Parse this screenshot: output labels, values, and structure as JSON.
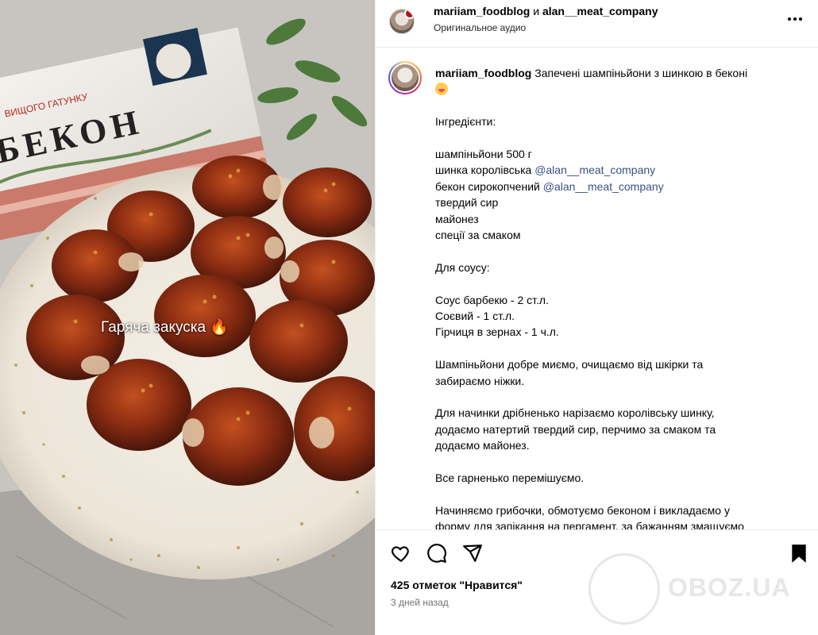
{
  "media": {
    "overlay_text": "Гаряча закуска",
    "package_text_top": "ВИЩОГО ГАТУНКУ",
    "package_text_main": "БЕКОН"
  },
  "header": {
    "user1": "mariiam_foodblog",
    "and": "и",
    "user2": "alan__meat_company",
    "audio": "Оригинальное аудио"
  },
  "caption": {
    "username": "mariiam_foodblog",
    "title": "Запечені шампіньйони з шинкою в беконі",
    "lines": [
      "",
      "Інгредієнти:",
      "",
      "шампіньйони 500 г"
    ],
    "ham_text": "шинка королівська ",
    "ham_mention": "@alan__meat_company",
    "bacon_text": "бекон сирокопчений ",
    "bacon_mention": "@alan__meat_company",
    "lines_after": [
      "твердий сир",
      "майонез",
      "спеції за смаком",
      "",
      "Для соусу:",
      "",
      "Соус барбекю - 2 ст.л.",
      "Соєвий - 1 ст.л.",
      "Гірчиця в зернах - 1 ч.л.",
      "",
      "Шампіньйони добре миємо, очищаємо від шкірки та",
      "забираємо ніжки.",
      "",
      "Для начинки дрібненько нарізаємо королівську шинку,",
      "додаємо натертий твердий сир, перчимо за смаком та",
      "додаємо майонез.",
      "",
      "Все гарненько перемішуємо.",
      "",
      "Начиняємо грибочки, обмотуємо беконом і викладаємо у",
      "форму для запікання на пергамент, за бажанням змащуємо"
    ]
  },
  "actions": {
    "like_icon": "heart-icon",
    "comment_icon": "comment-icon",
    "share_icon": "share-icon",
    "save_icon": "bookmark-icon"
  },
  "likes": "425 отметок \"Нравится\"",
  "date": "3 дней назад",
  "watermark": "OBOZ.UA"
}
